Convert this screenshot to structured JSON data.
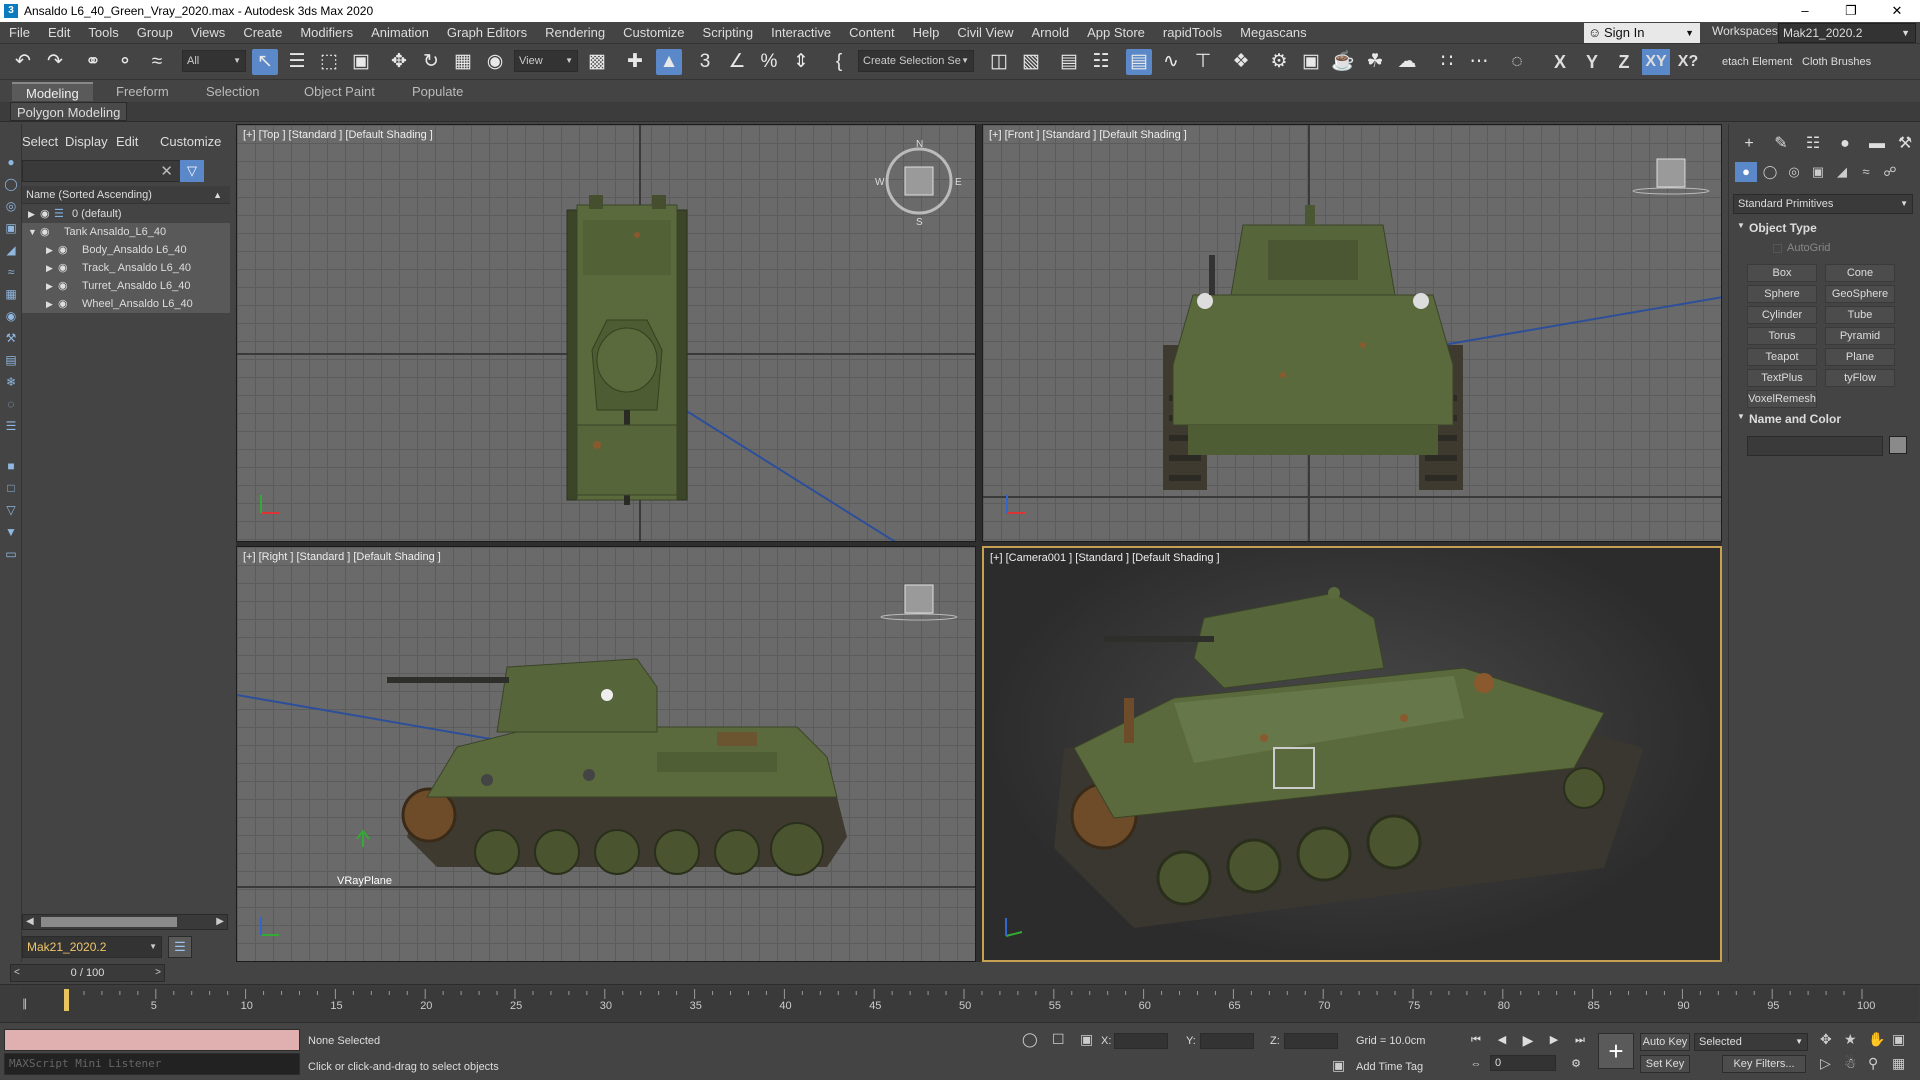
{
  "window": {
    "title": "Ansaldo L6_40_Green_Vray_2020.max - Autodesk 3ds Max 2020",
    "app_icon": "3"
  },
  "menubar": {
    "items": [
      "File",
      "Edit",
      "Tools",
      "Group",
      "Views",
      "Create",
      "Modifiers",
      "Animation",
      "Graph Editors",
      "Rendering",
      "Customize",
      "Scripting",
      "Interactive",
      "Content",
      "Help",
      "Civil View",
      "Arnold",
      "App Store",
      "rapidTools",
      "Megascans"
    ],
    "sign_in": "Sign In",
    "workspaces_label": "Workspaces:",
    "workspace_value": "Mak21_2020.2"
  },
  "toolbar": {
    "selection_filter": "All",
    "ref_coord": "View",
    "named_selection": "Create Selection Se",
    "axis_x": "X",
    "axis_y": "Y",
    "axis_z": "Z",
    "axis_xy": "XY",
    "axis_xq": "X?",
    "extra1": "etach Element",
    "extra2": "Cloth Brushes"
  },
  "ribbon": {
    "tabs": [
      "Modeling",
      "Freeform",
      "Selection",
      "Object Paint",
      "Populate"
    ],
    "active_tab": "Modeling",
    "panel": "Polygon Modeling"
  },
  "scene_explorer": {
    "tabs": [
      "Select",
      "Display",
      "Edit",
      "Customize"
    ],
    "column_header": "Name (Sorted Ascending)",
    "rows": [
      {
        "label": "0 (default)",
        "level": 0,
        "expanded": false
      },
      {
        "label": "Tank Ansaldo_L6_40",
        "level": 0,
        "expanded": true
      },
      {
        "label": "Body_Ansaldo L6_40",
        "level": 1,
        "expanded": false
      },
      {
        "label": "Track_ Ansaldo L6_40",
        "level": 1,
        "expanded": false
      },
      {
        "label": "Turret_Ansaldo L6_40",
        "level": 1,
        "expanded": false
      },
      {
        "label": "Wheel_Ansaldo L6_40",
        "level": 1,
        "expanded": false
      }
    ],
    "workspace": "Mak21_2020.2"
  },
  "viewports": {
    "top": "[+] [Top ] [Standard ] [Default Shading ]",
    "front": "[+] [Front ] [Standard ] [Default Shading ]",
    "right": "[+] [Right ] [Standard ] [Default Shading ]",
    "camera": "[+] [Camera001 ] [Standard ] [Default Shading ]",
    "vray_plane": "VRayPlane",
    "colors": {
      "tank_green": "#5b6a3c",
      "tank_dark": "#3f4a2a",
      "rust": "#8a5a2e",
      "active_border": "#c8a052"
    }
  },
  "command_panel": {
    "dropdown": "Standard Primitives",
    "object_type": "Object Type",
    "autogrid": "AutoGrid",
    "buttons": [
      "Box",
      "Cone",
      "Sphere",
      "GeoSphere",
      "Cylinder",
      "Tube",
      "Torus",
      "Pyramid",
      "Teapot",
      "Plane",
      "TextPlus",
      "tyFlow",
      "VoxelRemesh"
    ],
    "name_color": "Name and Color"
  },
  "timeline": {
    "frame": "0 / 100",
    "ticks": [
      "5",
      "10",
      "15",
      "20",
      "25",
      "30",
      "35",
      "40",
      "45",
      "50",
      "55",
      "60",
      "65",
      "70",
      "75",
      "80",
      "85",
      "90",
      "95",
      "100"
    ]
  },
  "status": {
    "maxscript": "MAXScript Mini Listener",
    "selection": "None Selected",
    "prompt": "Click or click-and-drag to select objects",
    "x_label": "X:",
    "y_label": "Y:",
    "z_label": "Z:",
    "grid": "Grid = 10.0cm",
    "add_time_tag": "Add Time Tag",
    "auto_key": "Auto Key",
    "set_key": "Set Key",
    "key_filter_value": "Selected",
    "key_filters": "Key Filters...",
    "frame_value": "0"
  }
}
